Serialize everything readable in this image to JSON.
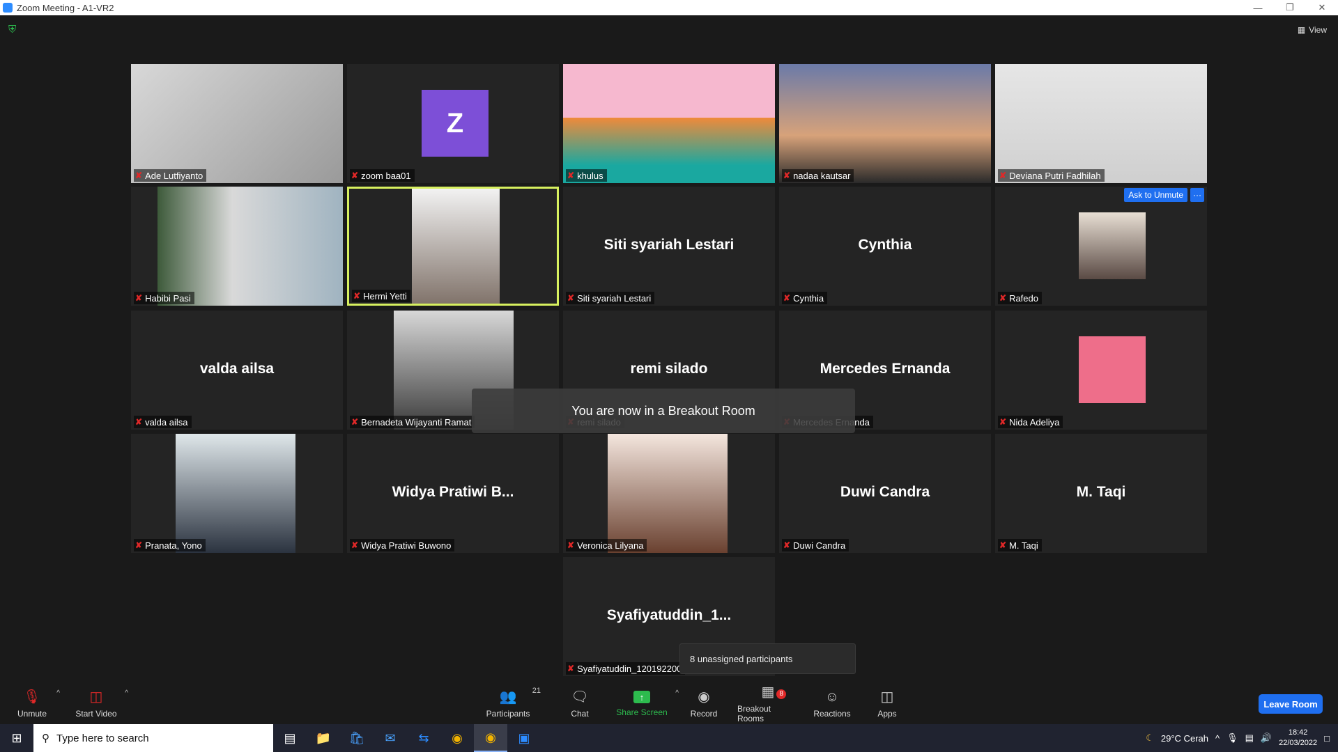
{
  "window": {
    "title": "Zoom Meeting - A1-VR2"
  },
  "view_label": "View",
  "tiles": [
    {
      "name": "Ade Lutfiyanto",
      "big": ""
    },
    {
      "name": "zoom baa01",
      "big": "",
      "avatar": "Z"
    },
    {
      "name": "khulus",
      "big": ""
    },
    {
      "name": "nadaa kautsar",
      "big": ""
    },
    {
      "name": "Deviana Putri Fadhilah",
      "big": ""
    },
    {
      "name": "Habibi Pasi",
      "big": ""
    },
    {
      "name": "Hermi Yetti",
      "big": ""
    },
    {
      "name": "Siti syariah Lestari",
      "big": "Siti syariah Lestari"
    },
    {
      "name": "Cynthia",
      "big": "Cynthia"
    },
    {
      "name": "Rafedo",
      "big": ""
    },
    {
      "name": "valda ailsa",
      "big": "valda ailsa"
    },
    {
      "name": "Bernadeta Wijayanti Ramat",
      "big": ""
    },
    {
      "name": "remi silado",
      "big": "remi silado"
    },
    {
      "name": "Mercedes Ernanda",
      "big": "Mercedes Ernanda"
    },
    {
      "name": "Nida Adeliya",
      "big": ""
    },
    {
      "name": "Pranata, Yono",
      "big": ""
    },
    {
      "name": "Widya Pratiwi Buwono",
      "big": "Widya Pratiwi B..."
    },
    {
      "name": "Veronica Lilyana",
      "big": ""
    },
    {
      "name": "Duwi Candra",
      "big": "Duwi Candra"
    },
    {
      "name": "M. Taqi",
      "big": "M. Taqi"
    },
    {
      "name": "Syafiyatuddin_120192200",
      "big": "Syafiyatuddin_1..."
    }
  ],
  "rafedo_actions": {
    "ask_to_unmute": "Ask to Unmute",
    "more": "···"
  },
  "toast": "You are now in a Breakout Room",
  "popup": "8 unassigned participants",
  "toolbar": {
    "unmute": "Unmute",
    "start_video": "Start Video",
    "participants": "Participants",
    "participants_count": "21",
    "chat": "Chat",
    "share_screen": "Share Screen",
    "record": "Record",
    "breakout_rooms": "Breakout Rooms",
    "breakout_badge": "8",
    "reactions": "Reactions",
    "apps": "Apps",
    "leave": "Leave Room"
  },
  "taskbar": {
    "search_placeholder": "Type here to search",
    "weather": "29°C  Cerah",
    "time": "18:42",
    "date": "22/03/2022"
  }
}
